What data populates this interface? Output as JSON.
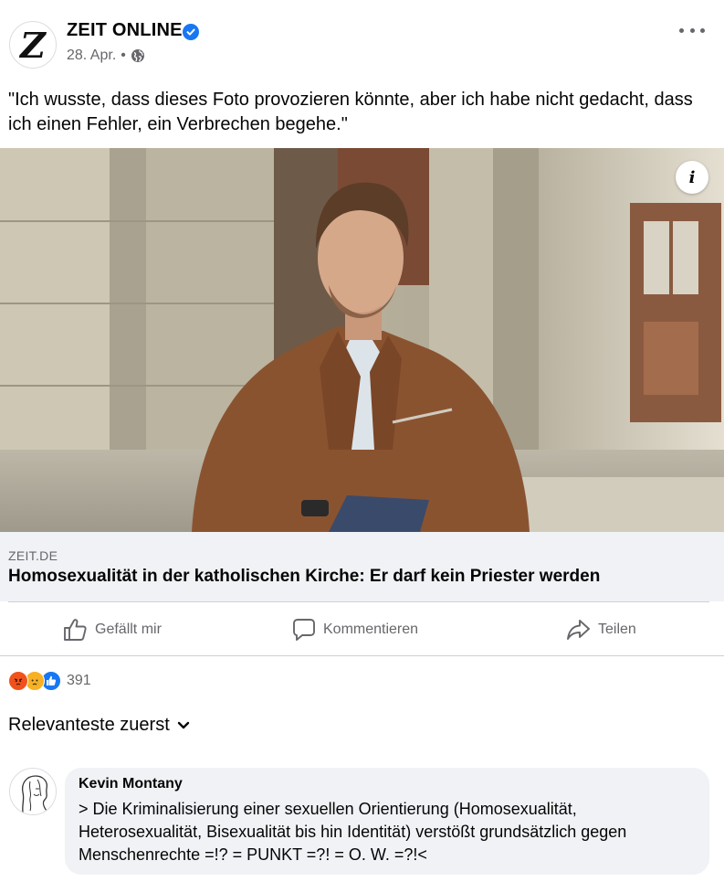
{
  "post": {
    "page_name": "ZEIT ONLINE",
    "avatar_letter": "Z",
    "date": "28. Apr.",
    "separator": "•",
    "text": "\"Ich wusste, dass dieses Foto provozieren könnte, aber ich habe nicht gedacht, dass ich einen Fehler, ein Verbrechen begehe.\"",
    "info_glyph": "i"
  },
  "link": {
    "domain": "ZEIT.DE",
    "title": "Homosexualität in der katholischen Kirche: Er darf kein Priester werden"
  },
  "actions": {
    "like_label": "Gefällt mir",
    "comment_label": "Kommentieren",
    "share_label": "Teilen"
  },
  "reactions": {
    "icons": [
      "angry-icon",
      "sad-icon",
      "like-icon"
    ],
    "count": "391"
  },
  "comments": {
    "sort_label": "Relevanteste zuerst",
    "items": [
      {
        "author": "Kevin Montany",
        "text": "> Die Kriminalisierung einer sexuellen Orientierung (Homosexualität, Heterosexualität, Bisexualität bis hin Identität) verstößt grundsätzlich gegen Menschenrechte =!? = PUNKT =?! = O. W. =?!<"
      }
    ]
  },
  "colors": {
    "verified": "#1877f2",
    "muted_text": "#65676b",
    "bubble": "#f0f2f5",
    "angry": "#f0521d",
    "sad": "#f7b125",
    "like": "#1877f2"
  }
}
